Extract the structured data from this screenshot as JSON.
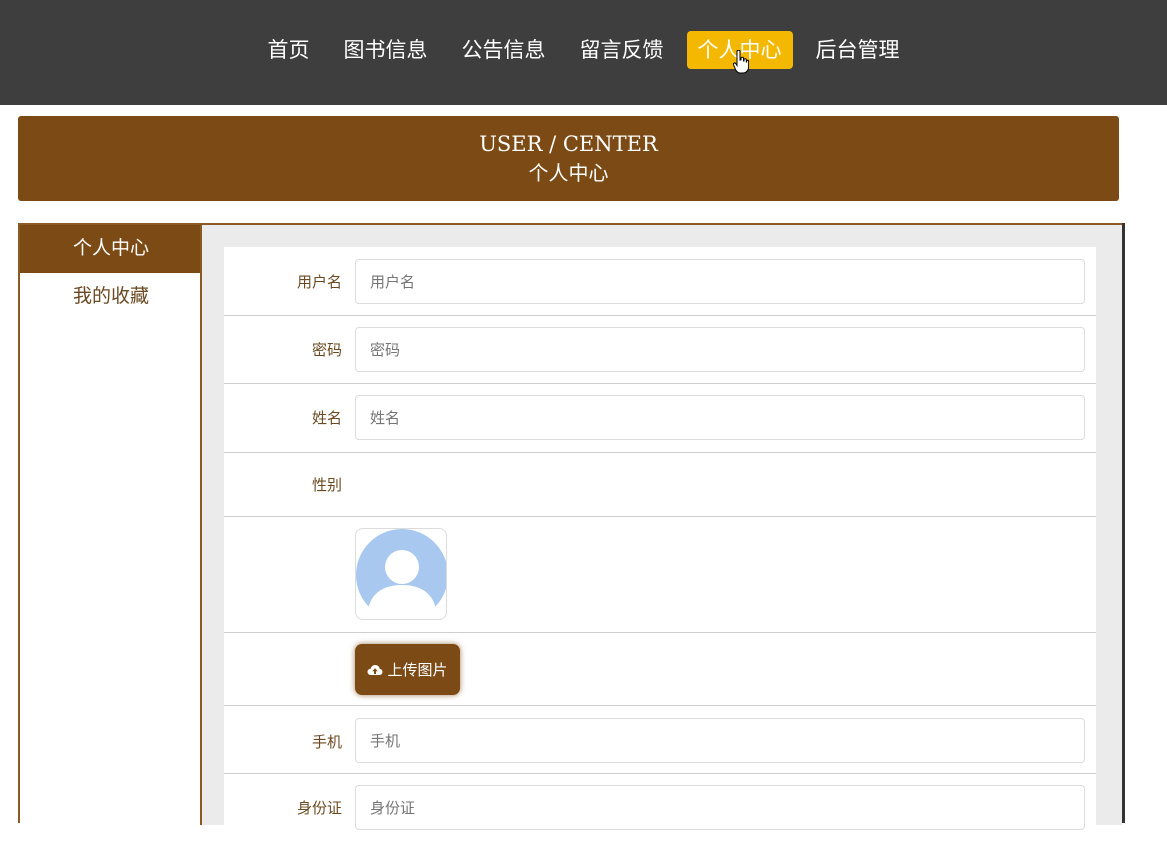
{
  "nav": {
    "items": [
      {
        "label": "首页",
        "active": false
      },
      {
        "label": "图书信息",
        "active": false
      },
      {
        "label": "公告信息",
        "active": false
      },
      {
        "label": "留言反馈",
        "active": false
      },
      {
        "label": "个人中心",
        "active": true
      },
      {
        "label": "后台管理",
        "active": false
      }
    ]
  },
  "banner": {
    "title_en": "USER / CENTER",
    "title_cn": "个人中心"
  },
  "sidebar": {
    "items": [
      {
        "label": "个人中心",
        "active": true
      },
      {
        "label": "我的收藏",
        "active": false
      }
    ]
  },
  "form": {
    "username": {
      "label": "用户名",
      "placeholder": "用户名",
      "value": ""
    },
    "password": {
      "label": "密码",
      "placeholder": "密码",
      "value": ""
    },
    "name": {
      "label": "姓名",
      "placeholder": "姓名",
      "value": ""
    },
    "gender": {
      "label": "性别"
    },
    "avatar": {
      "icon": "user-avatar-placeholder-icon"
    },
    "upload": {
      "label": "上传图片",
      "icon": "cloud-upload-icon"
    },
    "phone": {
      "label": "手机",
      "placeholder": "手机",
      "value": ""
    },
    "idcard": {
      "label": "身份证",
      "placeholder": "身份证",
      "value": ""
    }
  },
  "colors": {
    "topbar": "#3e3e3e",
    "accent_brown": "#7c4a14",
    "active_nav": "#f5b800",
    "label_brown": "#6b4a22"
  }
}
